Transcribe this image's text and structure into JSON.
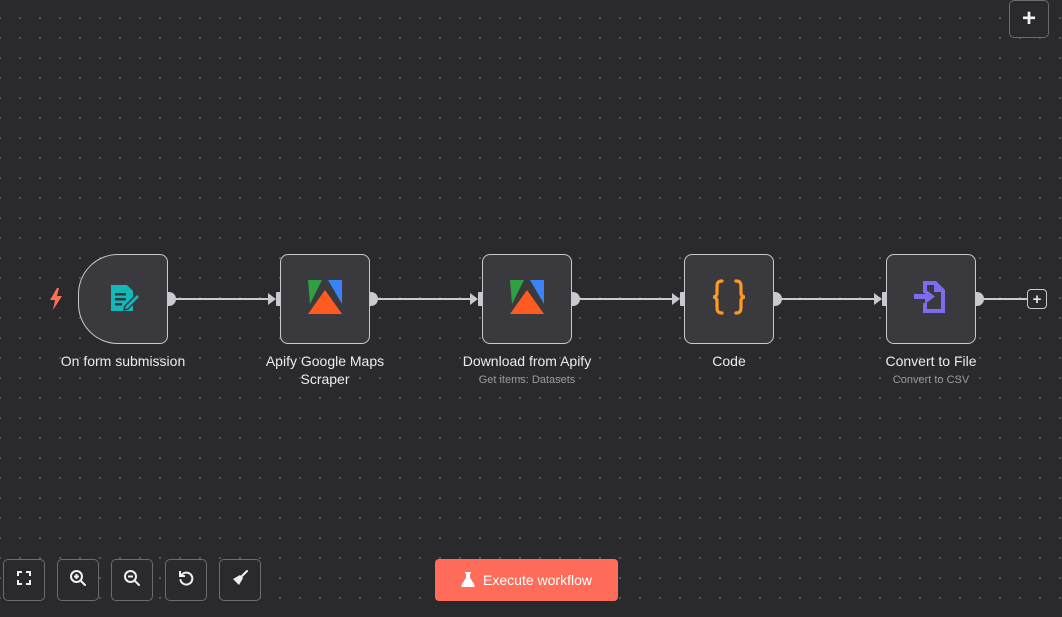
{
  "canvas": {
    "add_button_label": "+",
    "end_plus_label": "+"
  },
  "nodes": [
    {
      "label": "On form submission",
      "subtitle": "",
      "icon": "form-icon"
    },
    {
      "label": "Apify Google Maps Scraper",
      "subtitle": "",
      "icon": "apify-icon"
    },
    {
      "label": "Download from Apify",
      "subtitle": "Get items: Datasets",
      "icon": "apify-icon"
    },
    {
      "label": "Code",
      "subtitle": "",
      "icon": "code-braces-icon"
    },
    {
      "label": "Convert to File",
      "subtitle": "Convert to CSV",
      "icon": "convert-file-icon"
    }
  ],
  "toolbar": {
    "buttons": [
      "zoom-to-fit",
      "zoom-in",
      "zoom-out",
      "reset-zoom",
      "tidy-up"
    ],
    "execute_label": "Execute workflow"
  },
  "colors": {
    "execute": "#ff6d5a",
    "trigger_bolt": "#ff6d5a",
    "form_icon": "#14b8b8",
    "code_icon": "#ff9922",
    "convert_icon": "#7b6cf0"
  }
}
